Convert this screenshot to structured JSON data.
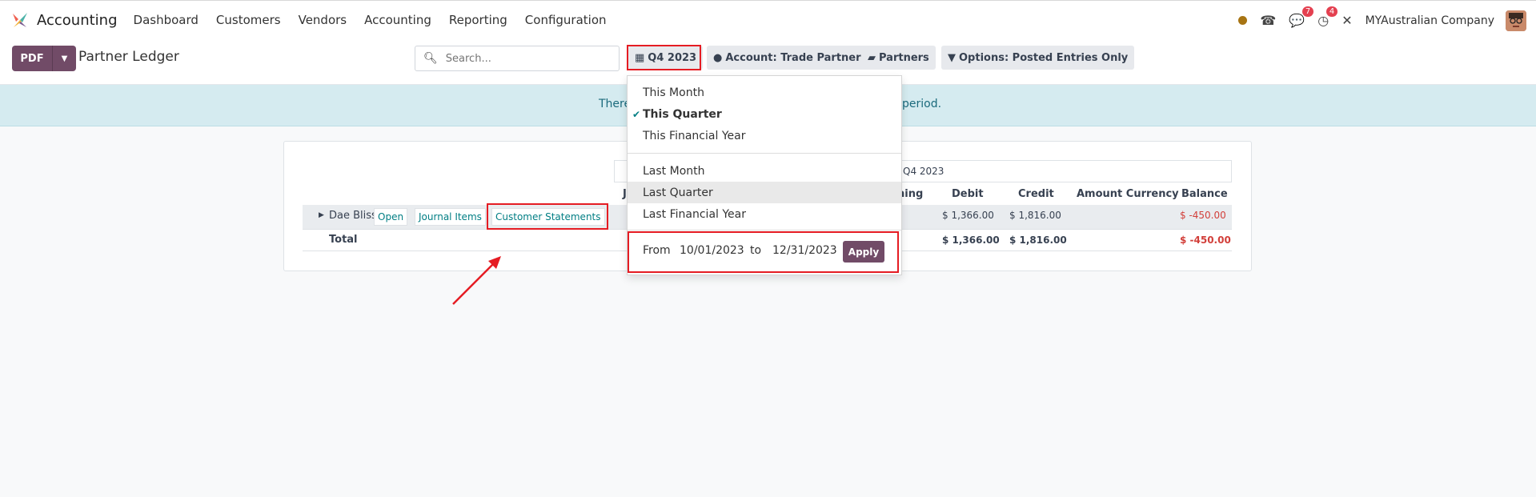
{
  "navbar": {
    "app_name": "Accounting",
    "menu": [
      "Dashboard",
      "Customers",
      "Vendors",
      "Accounting",
      "Reporting",
      "Configuration"
    ],
    "chat_badge": "7",
    "activity_badge": "4",
    "company": "MYAustralian Company"
  },
  "control": {
    "pdf_label": "PDF",
    "page_title": "Partner Ledger",
    "search_placeholder": "Search...",
    "filters": {
      "date": "Q4 2023",
      "account": "Account: Trade Partners",
      "partners": "Partners",
      "options": "Options: Posted Entries Only"
    }
  },
  "alert": {
    "left_fragment": "There",
    "right_fragment": "period."
  },
  "report": {
    "period_label": "Q4 2023",
    "columns": {
      "j_fragment": "J",
      "matching_fragment": "hing",
      "debit": "Debit",
      "credit": "Credit",
      "amount_currency": "Amount Currency",
      "balance": "Balance"
    },
    "row": {
      "partner": "Dae Bliss",
      "open": "Open",
      "journal_items": "Journal Items",
      "customer_statements": "Customer Statements",
      "debit": "$ 1,366.00",
      "credit": "$ 1,816.00",
      "balance": "$ -450.00"
    },
    "total": {
      "label": "Total",
      "debit": "$ 1,366.00",
      "credit": "$ 1,816.00",
      "balance": "$ -450.00"
    }
  },
  "date_dropdown": {
    "group1": [
      "This Month",
      "This Quarter",
      "This Financial Year"
    ],
    "group2": [
      "Last Month",
      "Last Quarter",
      "Last Financial Year"
    ],
    "selected": "This Quarter",
    "highlighted": "Last Quarter",
    "from_label": "From",
    "from_value": "10/01/2023",
    "to_label": "to",
    "to_value": "12/31/2023",
    "apply_label": "Apply"
  },
  "colors": {
    "brand": "#714b67",
    "annotation_red": "#e51c23",
    "link_teal": "#017e84",
    "negative": "#d23f3a"
  }
}
